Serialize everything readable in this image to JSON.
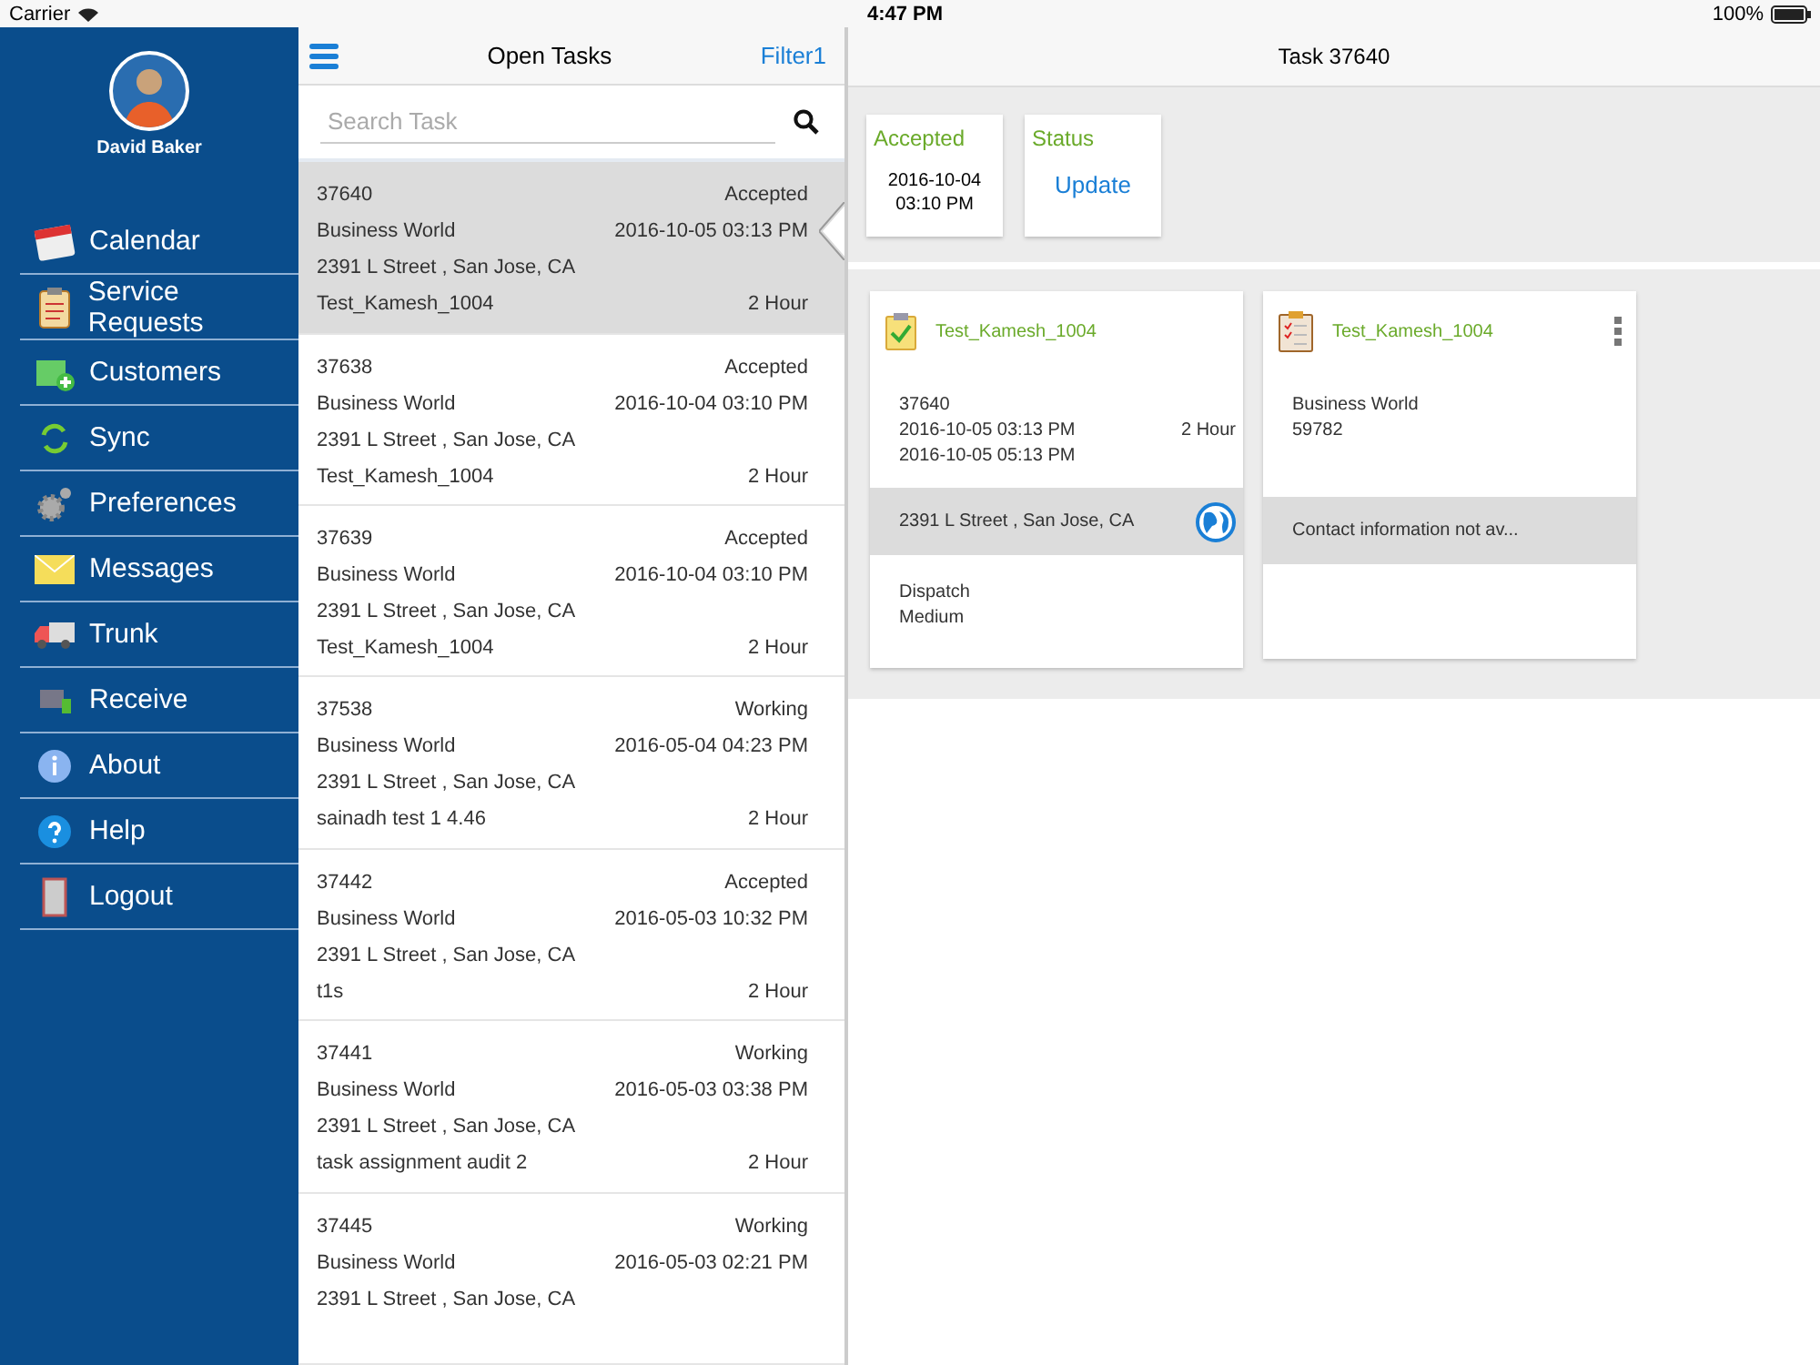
{
  "status_bar": {
    "carrier": "Carrier",
    "time": "4:47 PM",
    "battery": "100%"
  },
  "sidebar": {
    "user": "David Baker",
    "items": [
      {
        "label": "Calendar"
      },
      {
        "label": "Service Requests"
      },
      {
        "label": "Customers"
      },
      {
        "label": "Sync"
      },
      {
        "label": "Preferences"
      },
      {
        "label": "Messages"
      },
      {
        "label": "Trunk"
      },
      {
        "label": "Receive"
      },
      {
        "label": "About"
      },
      {
        "label": "Help"
      },
      {
        "label": "Logout"
      }
    ]
  },
  "task_list": {
    "title": "Open Tasks",
    "filter": "Filter1",
    "search": {
      "placeholder": "Search Task"
    },
    "tasks": [
      {
        "id": "37640",
        "status": "Accepted",
        "customer": "Business World",
        "date": "2016-10-05 03:13 PM",
        "address": "2391 L Street , San Jose, CA",
        "name": "Test_Kamesh_1004",
        "duration": "2 Hour",
        "selected": true
      },
      {
        "id": "37638",
        "status": "Accepted",
        "customer": "Business World",
        "date": "2016-10-04 03:10 PM",
        "address": "2391 L Street , San Jose, CA",
        "name": "Test_Kamesh_1004",
        "duration": "2 Hour",
        "selected": false
      },
      {
        "id": "37639",
        "status": "Accepted",
        "customer": "Business World",
        "date": "2016-10-04 03:10 PM",
        "address": "2391 L Street , San Jose, CA",
        "name": "Test_Kamesh_1004",
        "duration": "2 Hour",
        "selected": false
      },
      {
        "id": "37538",
        "status": "Working",
        "customer": "Business World",
        "date": "2016-05-04 04:23 PM",
        "address": "2391 L Street , San Jose, CA",
        "name": "sainadh test 1 4.46",
        "duration": "2 Hour",
        "selected": false
      },
      {
        "id": "37442",
        "status": "Accepted",
        "customer": "Business World",
        "date": "2016-05-03 10:32 PM",
        "address": "2391 L Street , San Jose, CA",
        "name": "t1s",
        "duration": "2 Hour",
        "selected": false
      },
      {
        "id": "37441",
        "status": "Working",
        "customer": "Business World",
        "date": "2016-05-03 03:38 PM",
        "address": "2391 L Street , San Jose, CA",
        "name": "task assignment audit 2",
        "duration": "2 Hour",
        "selected": false
      },
      {
        "id": "37445",
        "status": "Working",
        "customer": "Business World",
        "date": "2016-05-03 02:21 PM",
        "address": "2391 L Street , San Jose, CA",
        "selected": false
      }
    ]
  },
  "detail": {
    "title": "Task 37640",
    "status_card": {
      "status": "Accepted",
      "date": "2016-10-04",
      "time": "03:10 PM"
    },
    "update_card": {
      "label": "Status",
      "action": "Update"
    },
    "task_card": {
      "name": "Test_Kamesh_1004",
      "id": "37640",
      "start": "2016-10-05 03:13 PM",
      "end": "2016-10-05 05:13 PM",
      "duration": "2 Hour",
      "address": "2391 L Street , San Jose, CA",
      "type": "Dispatch",
      "priority": "Medium"
    },
    "customer_card": {
      "name": "Test_Kamesh_1004",
      "customer": "Business World",
      "number": "59782",
      "contact": "Contact information not av..."
    }
  }
}
